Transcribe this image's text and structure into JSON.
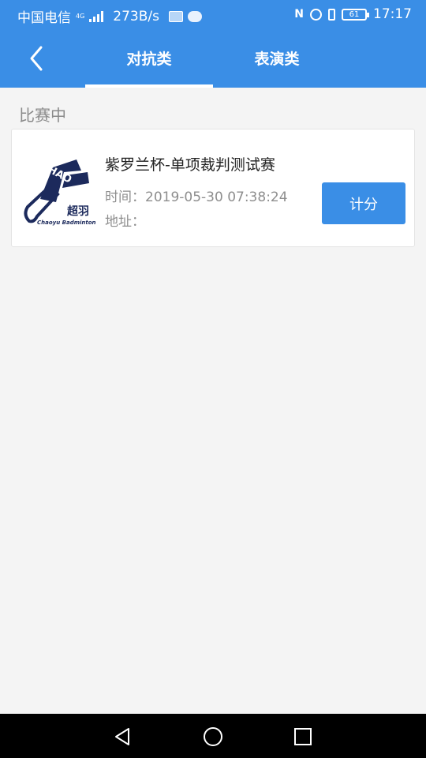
{
  "status_bar": {
    "carrier": "中国电信",
    "network_type": "4G",
    "speed": "273B/s",
    "battery": "61",
    "time": "17:17"
  },
  "header": {
    "tabs": [
      {
        "label": "对抗类",
        "active": true
      },
      {
        "label": "表演类",
        "active": false
      }
    ]
  },
  "section": {
    "label": "比赛中"
  },
  "matches": [
    {
      "title": "紫罗兰杯-单项裁判测试赛",
      "time_label": "时间：",
      "time_value": "2019-05-30 07:38:24",
      "address_label": "地址：",
      "address_value": "",
      "button_label": "计分",
      "logo": {
        "text_top": "CHAO",
        "text_cn": "超羽",
        "text_en": "Chaoyu Badminton"
      }
    }
  ],
  "colors": {
    "primary": "#3a8ee6",
    "background": "#f4f4f4",
    "logo_navy": "#1c2a5c"
  },
  "icons": {
    "back": "chevron-left-icon",
    "nav_back": "triangle-back-icon",
    "nav_home": "circle-home-icon",
    "nav_recent": "square-recent-icon"
  }
}
